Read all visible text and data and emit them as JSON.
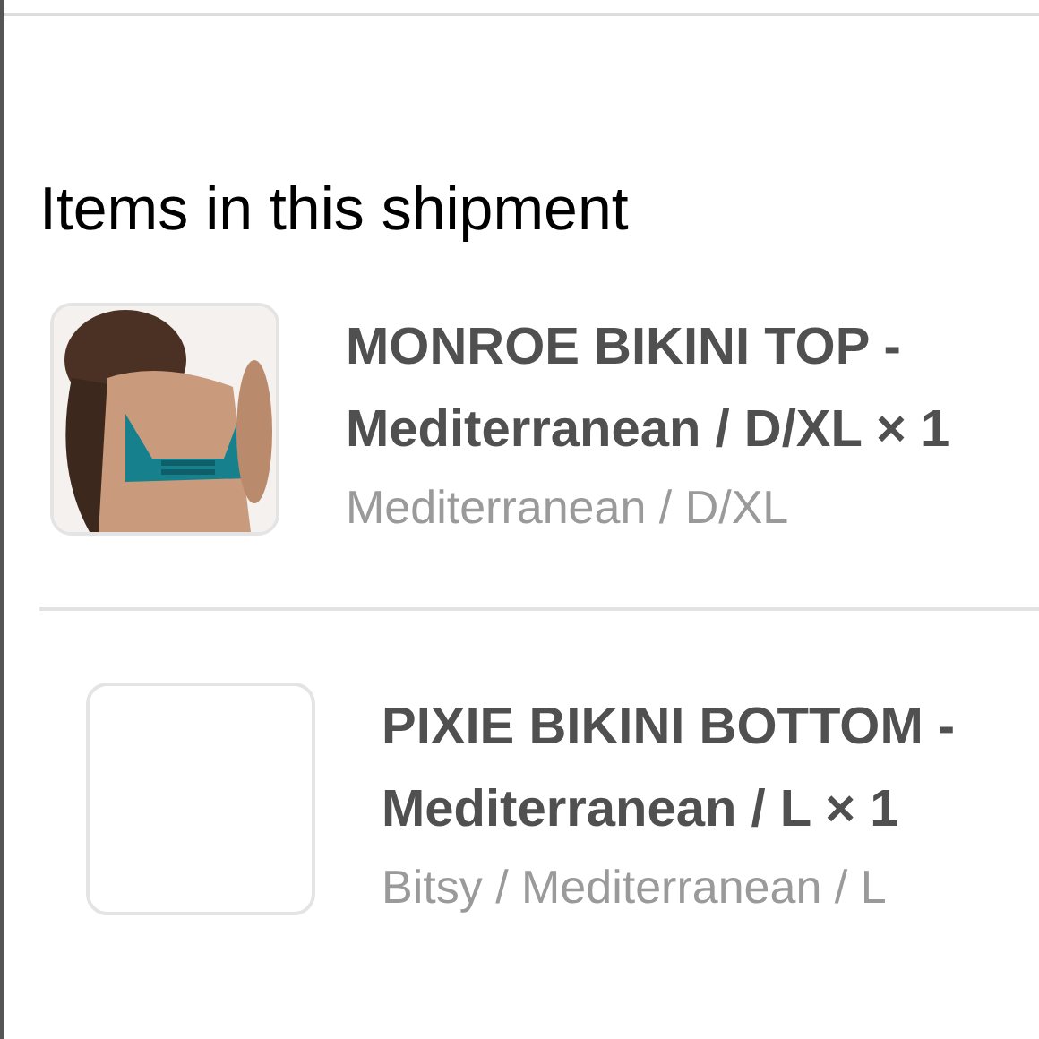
{
  "section_title": "Items in this shipment",
  "items": [
    {
      "title": "MONROE BIKINI TOP - Mediterranean / D/XL × 1",
      "variant": "Mediterranean / D/XL"
    },
    {
      "title": "PIXIE BIKINI BOTTOM - Mediterranean / L × 1",
      "variant": "Bitsy / Mediterranean / L",
      "thumbnail": {
        "kind": "blank"
      }
    }
  ]
}
